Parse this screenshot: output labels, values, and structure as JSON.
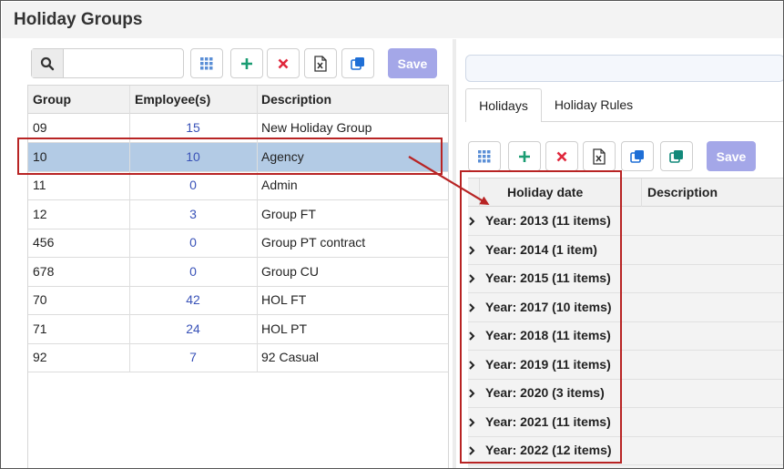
{
  "header": {
    "title": "Holiday Groups"
  },
  "left_toolbar": {
    "search": {
      "value": "",
      "placeholder": ""
    },
    "save_label": "Save"
  },
  "left_grid": {
    "columns": [
      "Group",
      "Employee(s)",
      "Description"
    ],
    "rows": [
      {
        "group": "09",
        "employees": "15",
        "description": "New Holiday Group"
      },
      {
        "group": "10",
        "employees": "10",
        "description": "Agency"
      },
      {
        "group": "11",
        "employees": "0",
        "description": "Admin"
      },
      {
        "group": "12",
        "employees": "3",
        "description": "Group FT"
      },
      {
        "group": "456",
        "employees": "0",
        "description": "Group PT contract"
      },
      {
        "group": "678",
        "employees": "0",
        "description": "Group CU"
      },
      {
        "group": "70",
        "employees": "42",
        "description": "HOL FT"
      },
      {
        "group": "71",
        "employees": "24",
        "description": "HOL PT"
      },
      {
        "group": "92",
        "employees": "7",
        "description": "92 Casual"
      }
    ],
    "selected_group": "10"
  },
  "right_panel": {
    "tabs": [
      "Holidays",
      "Holiday Rules"
    ],
    "active_tab": "Holidays",
    "save_label": "Save",
    "columns": [
      "Holiday date",
      "Description"
    ],
    "year_groups": [
      "Year: 2013 (11 items)",
      "Year: 2014 (1 item)",
      "Year: 2015 (11 items)",
      "Year: 2017 (10 items)",
      "Year: 2018 (11 items)",
      "Year: 2019 (11 items)",
      "Year: 2020 (3 items)",
      "Year: 2021 (11 items)",
      "Year: 2022 (12 items)"
    ]
  },
  "colors": {
    "selected_row": "#b3cbe5",
    "annotation_red": "#b82424",
    "save_button": "#a4a7e8",
    "count_link": "#3a53b8",
    "add_icon": "#1a9c72",
    "delete_icon": "#e0283c",
    "copy_icon": "#1f6fd6",
    "copy_alt_icon": "#12897a"
  },
  "icons": [
    "search-icon",
    "grid-icon",
    "add-icon",
    "delete-icon",
    "excel-icon",
    "copy-icon",
    "chevron-right-icon"
  ]
}
